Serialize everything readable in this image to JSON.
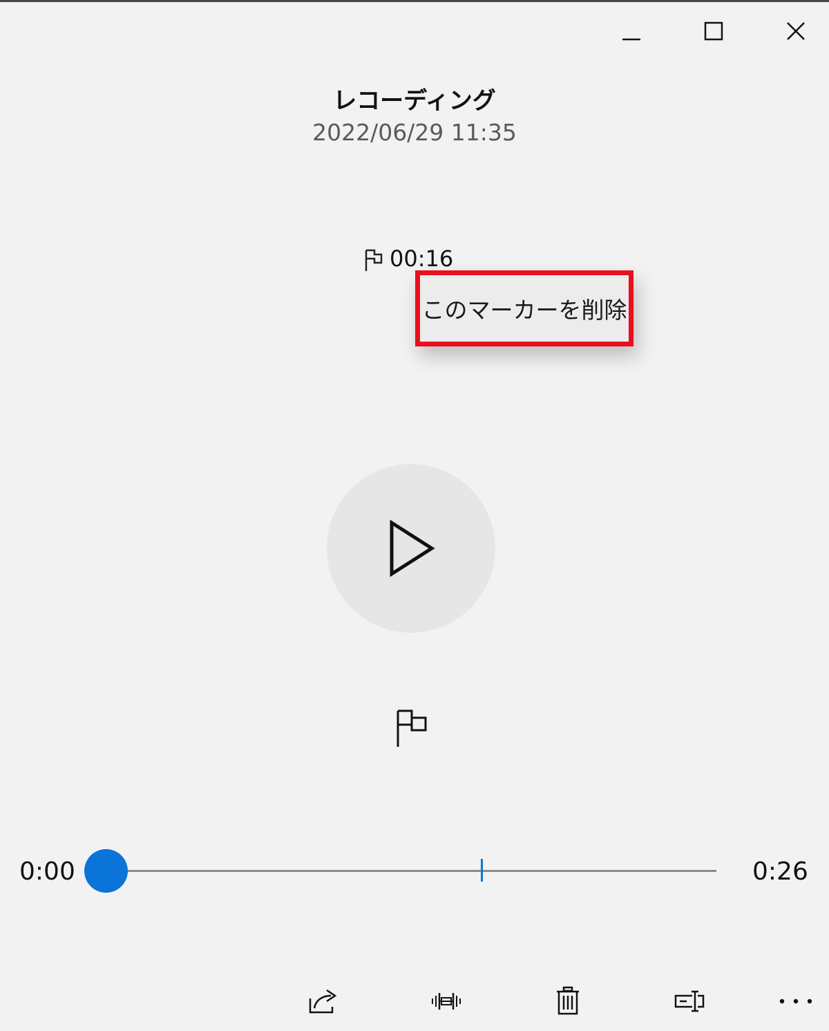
{
  "window": {
    "controls": [
      "minimize-icon",
      "maximize-icon",
      "close-icon"
    ]
  },
  "recording": {
    "title": "レコーディング",
    "date": "2022/06/29 11:35"
  },
  "marker": {
    "icon": "flag-icon",
    "time": "00:16"
  },
  "context_menu": {
    "items": [
      {
        "label": "このマーカーを削除"
      }
    ],
    "highlight_color": "#e8101e"
  },
  "player": {
    "play_icon": "play-icon",
    "add_marker_icon": "add-marker-flag-icon"
  },
  "timeline": {
    "start": "0:00",
    "end": "0:26",
    "position_fraction": 0.0,
    "marker_fraction": 0.615,
    "accent_color": "#0a74d8"
  },
  "toolbar": {
    "icons": [
      "share-icon",
      "trim-icon",
      "delete-icon",
      "rename-icon",
      "more-icon"
    ]
  }
}
